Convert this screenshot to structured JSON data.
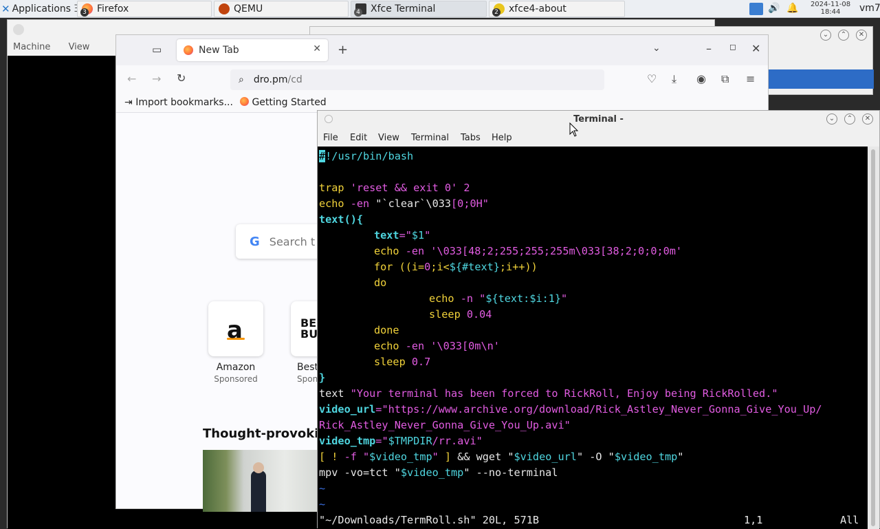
{
  "panel": {
    "applications": "Applications",
    "tasks": [
      {
        "label": "Firefox",
        "badge": "3"
      },
      {
        "label": "QEMU",
        "badge": ""
      },
      {
        "label": "Xfce Terminal",
        "badge": "4"
      },
      {
        "label": "xfce4-about",
        "badge": "2"
      }
    ],
    "date": "2024-11-08",
    "time": "18:44",
    "user": "vm7"
  },
  "qemu": {
    "menu": [
      "Machine",
      "View"
    ]
  },
  "firefox": {
    "tab_title": "New Tab",
    "url_host": "dro.pm",
    "url_path": "/cd",
    "bookmarks": [
      "Import bookmarks...",
      "Getting Started"
    ],
    "search_placeholder": "Search t",
    "tiles": [
      {
        "label": "Amazon",
        "sub": "Sponsored"
      },
      {
        "label": "Best",
        "sub": "Spon"
      }
    ],
    "section_title": "Thought-provokin"
  },
  "terminal": {
    "title": "Terminal -",
    "menu": [
      "File",
      "Edit",
      "View",
      "Terminal",
      "Tabs",
      "Help"
    ],
    "status_file": "\"~/Downloads/TermRoll.sh\" 20L, 571B",
    "status_pos": "1,1",
    "status_all": "All",
    "code": {
      "l1": "#!/usr/bin/bash",
      "l2a": "trap ",
      "l2b": "'reset && exit 0'",
      "l2c": " 2",
      "l3a": "echo ",
      "l3b": "-en",
      "l3c": " \"`clear`\\033",
      "l3d": "[0;0H\"",
      "l4": "text(){",
      "l5a": "text",
      "l5b": "=\"",
      "l5c": "$1",
      "l5d": "\"",
      "l6a": "echo ",
      "l6b": "-en",
      "l6c": " '\\033[48;2;255;255;255m\\033[38;2;0;0;0m'",
      "l7a": "for ",
      "l7b": "((i=",
      "l7c": "0",
      "l7d": ";i<",
      "l7e": "${#text}",
      "l7f": ";i++))",
      "l8": "do",
      "l9a": "echo ",
      "l9b": "-n",
      "l9c": " \"",
      "l9d": "${text:$i:1}",
      "l9e": "\"",
      "l10a": "sleep ",
      "l10b": "0.04",
      "l11": "done",
      "l12a": "echo ",
      "l12b": "-en",
      "l12c": " '\\033[0m\\n'",
      "l13a": "sleep ",
      "l13b": "0.7",
      "l14": "}",
      "l15a": "text ",
      "l15b": "\"Your terminal has been forced to RickRoll, Enjoy being RickRolled.\"",
      "l16a": "video_url",
      "l16b": "=\"https://www.archive.org/download/Rick_Astley_Never_Gonna_Give_You_Up/",
      "l17": "Rick_Astley_Never_Gonna_Give_You_Up.avi\"",
      "l18a": "video_tmp",
      "l18b": "=\"",
      "l18c": "$TMPDIR",
      "l18d": "/rr.avi\"",
      "l19a": "[ ! ",
      "l19b": "-f",
      "l19c": " \"",
      "l19d": "$video_tmp",
      "l19e": "\" ",
      "l19f": "]",
      "l19g": " && wget \"",
      "l19h": "$video_url",
      "l19i": "\" -O \"",
      "l19j": "$video_tmp",
      "l19k": "\"",
      "l20a": "mpv -vo=tct \"",
      "l20b": "$video_tmp",
      "l20c": "\" --no-terminal",
      "tilde": "~"
    }
  }
}
